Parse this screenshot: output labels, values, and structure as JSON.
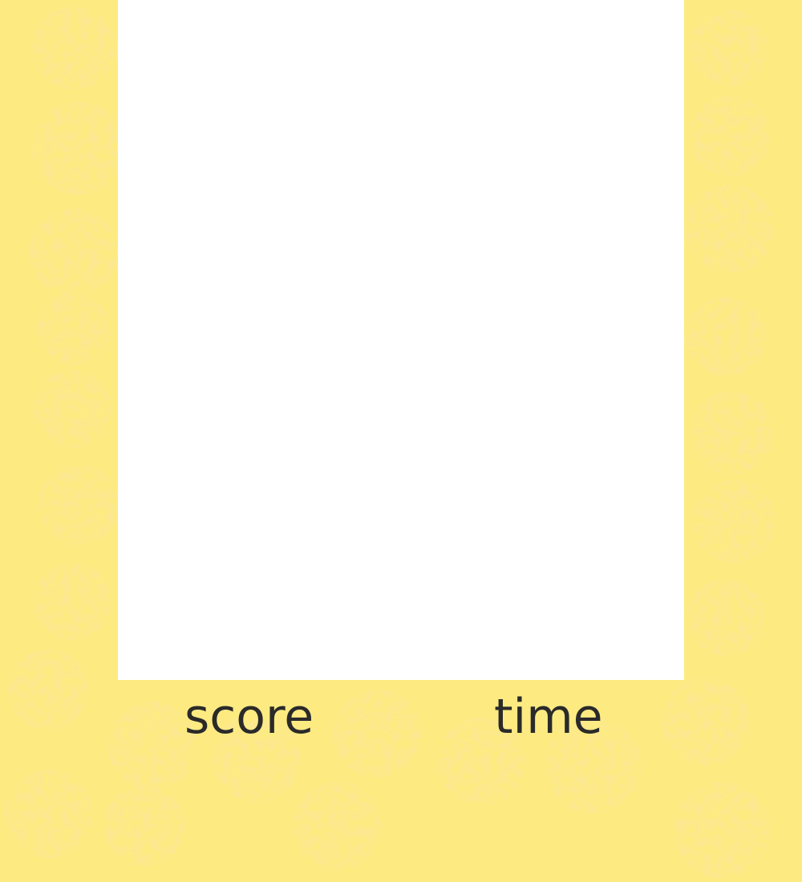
{
  "hud": {
    "score_label": "score",
    "time_label": "time"
  },
  "colors": {
    "background": "#fdeb82",
    "texture_blotch": "#f7c66a",
    "playfield": "#ffffff",
    "label_text": "#2b2a2a"
  }
}
